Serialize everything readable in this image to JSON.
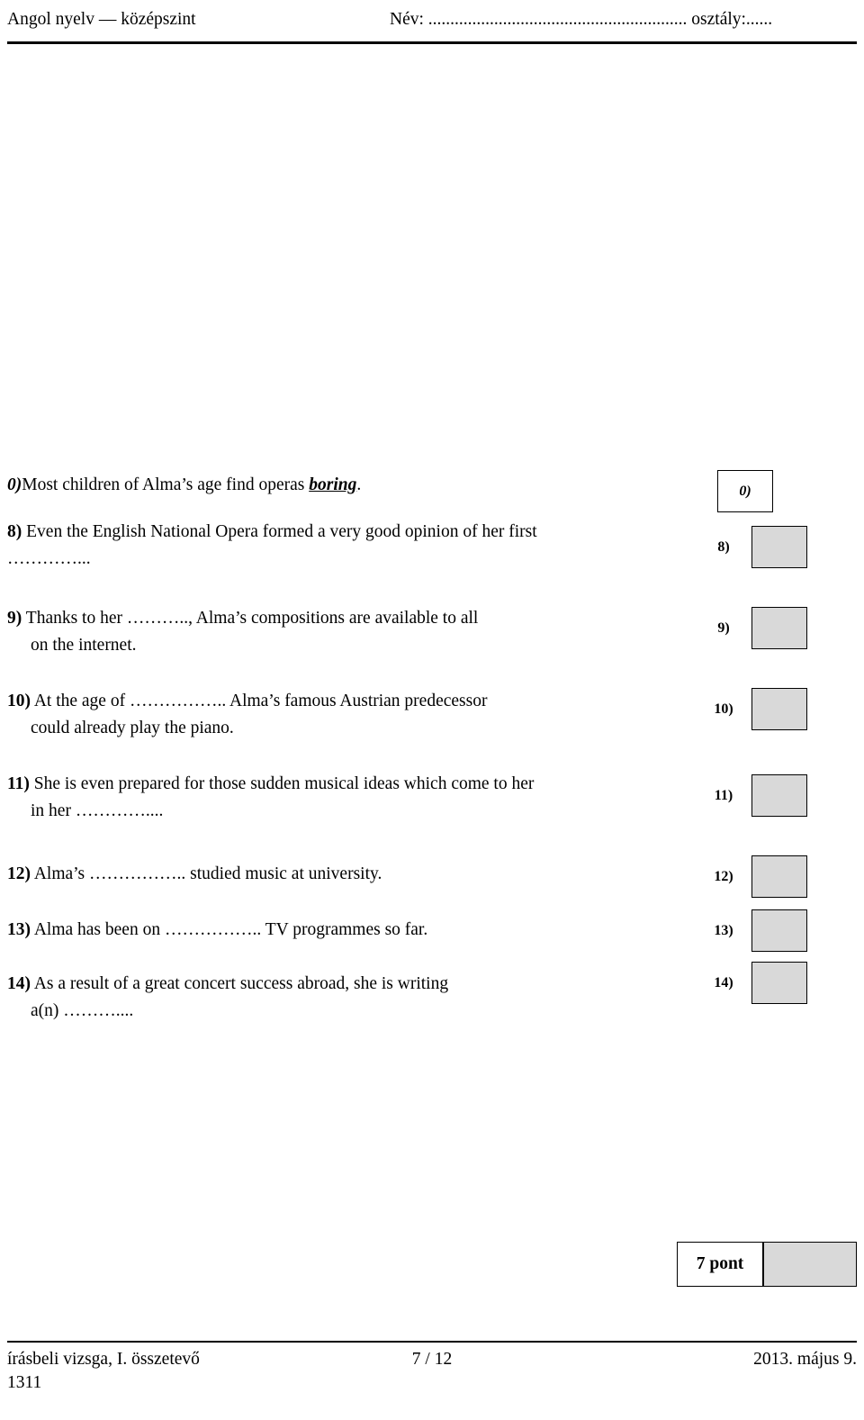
{
  "header": {
    "left": "Angol nyelv — középszint",
    "right": "Név: ...........................................................  osztály:......"
  },
  "exercise": {
    "items": [
      {
        "num": "0)",
        "num_style": "bold-italic",
        "text_before": "Most children of Alma’s age find operas ",
        "keyword": "boring",
        "text_after": ".",
        "answer_label": "0)",
        "answer_label_style": "bold-italic",
        "answer_filled": false
      },
      {
        "num": "8)",
        "line1": "Even the English National Opera formed a very good opinion of her first",
        "line2": "…………...",
        "answer_label": "8)"
      },
      {
        "num": "9)",
        "line1": "Thanks to her ……….., Alma’s compositions are available to all",
        "line2": "on the internet.",
        "answer_label": "9)"
      },
      {
        "num": "10)",
        "line1": "At  the  age  of ……………..  Alma’s  famous  Austrian  predecessor",
        "line2": "could already play the piano.",
        "answer_label": "10)"
      },
      {
        "num": "11)",
        "line1": "She is even prepared for those sudden musical ideas which come to her",
        "line2": "in her …………....",
        "answer_label": "11)"
      },
      {
        "num": "12)",
        "line1": "Alma’s …………….. studied music at university.",
        "answer_label": "12)"
      },
      {
        "num": "13)",
        "line1": "Alma has been on …………….. TV programmes so far.",
        "answer_label": "13)"
      },
      {
        "num": "14)",
        "line1": "As  a  result  of  a  great  concert  success  abroad,  she  is  writing",
        "line2": "a(n) ………....",
        "answer_label": "14)"
      }
    ],
    "points_label": "7 pont"
  },
  "footer": {
    "left": "írásbeli vizsga, I. összetevő",
    "center": "7 / 12",
    "right": "2013. május 9.",
    "code": "1311"
  }
}
